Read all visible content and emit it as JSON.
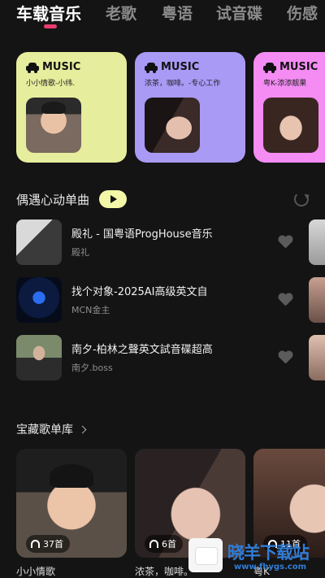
{
  "tabs": [
    "车载音乐",
    "老歌",
    "粤语",
    "试音碟",
    "伤感"
  ],
  "cards": [
    {
      "title": "MUSIC",
      "subtitle": "小小情歌-小纬.",
      "color": "#e6ed9c"
    },
    {
      "title": "MUSIC",
      "subtitle": "浓茶，咖啡。-专心工作",
      "color": "#a99af6"
    },
    {
      "title": "MUSIC",
      "subtitle": "粤K-添添靓果",
      "color": "#f48cf4"
    }
  ],
  "recommend": {
    "title": "偶遇心动单曲"
  },
  "songs": [
    {
      "title": "殿礼 - 国粤语ProgHouse音乐",
      "artist": "殿礼"
    },
    {
      "title": "找个对象-2025AI高级英文自",
      "artist": "MCN金主"
    },
    {
      "title": "南夕-柏林之聲英文試音碟超高",
      "artist": "南夕.boss"
    }
  ],
  "library": {
    "title": "宝藏歌单库",
    "playlists": [
      {
        "count": "37首",
        "name": "小小情歌"
      },
      {
        "count": "6首",
        "name": "浓茶，咖啡。"
      },
      {
        "count": "11首",
        "name": "粤K"
      }
    ]
  },
  "watermark": {
    "text": "晓羊下载站",
    "url": "www.fhygs.com"
  }
}
